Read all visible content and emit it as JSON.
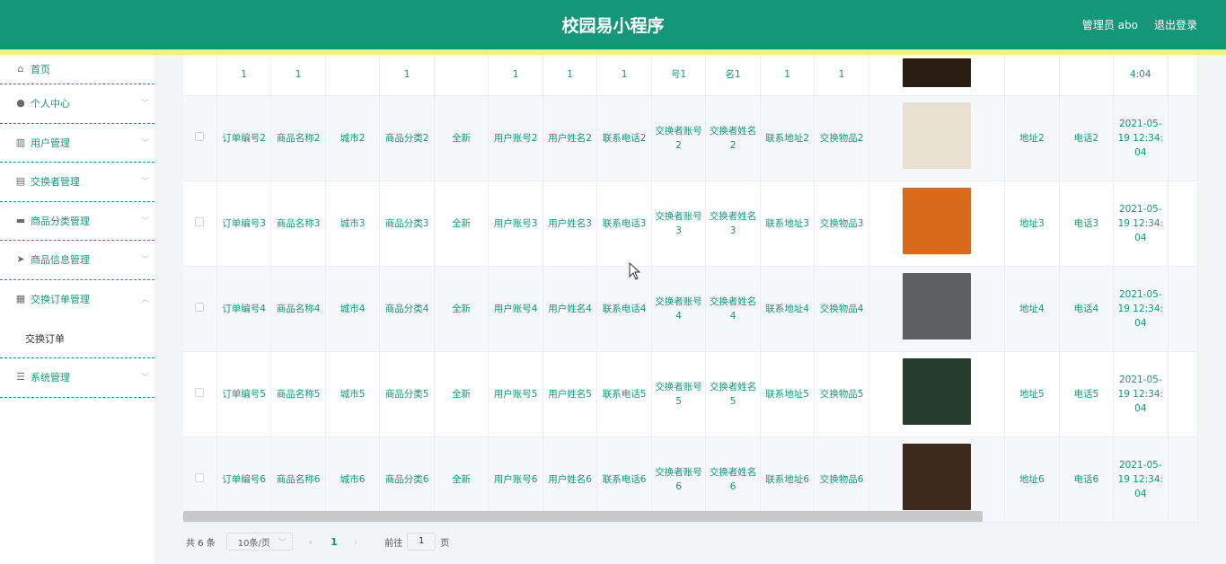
{
  "header": {
    "title": "校园易小程序",
    "admin": "管理员 abo",
    "logout": "退出登录",
    "accent": "#149778",
    "stripe": "#f6ef7a"
  },
  "sidebar": {
    "items": [
      {
        "label": "首页",
        "icon": "home-icon",
        "glyph": "⌂",
        "expanded": null
      },
      {
        "label": "个人中心",
        "icon": "user-icon",
        "glyph": "●",
        "expanded": false
      },
      {
        "label": "用户管理",
        "icon": "bar-chart-icon",
        "glyph": "▥",
        "expanded": false
      },
      {
        "label": "交换者管理",
        "icon": "clipboard-icon",
        "glyph": "▤",
        "expanded": false
      },
      {
        "label": "商品分类管理",
        "icon": "folder-icon",
        "glyph": "▬",
        "expanded": false
      },
      {
        "label": "商品信息管理",
        "icon": "send-icon",
        "glyph": "➤",
        "expanded": false
      },
      {
        "label": "交换订单管理",
        "icon": "grid-icon",
        "glyph": "▦",
        "expanded": true
      },
      {
        "label": "系统管理",
        "icon": "menu-icon",
        "glyph": "☰",
        "expanded": false
      }
    ],
    "submenu": "交换订单"
  },
  "table": {
    "partial_row": {
      "c1": "1",
      "c2": "1",
      "c4": "1",
      "c6": "1",
      "c7": "1",
      "c8": "1",
      "c9": "号1",
      "c10": "名1",
      "c11": "1",
      "c12": "1",
      "time": "4:04"
    },
    "rows": [
      {
        "order": "订单编号2",
        "goods": "商品名称2",
        "city": "城市2",
        "category": "商品分类2",
        "cond": "全新",
        "account": "用户账号2",
        "uname": "用户姓名2",
        "phone": "联系电话2",
        "xacc": "交换者账号2",
        "xname": "交换者姓名2",
        "addr": "联系地址2",
        "item": "交换物品2",
        "img_color": "#e9e1cf",
        "addr2": "地址2",
        "tel": "电话2",
        "time": "2021-05-19 12:34:04"
      },
      {
        "order": "订单编号3",
        "goods": "商品名称3",
        "city": "城市3",
        "category": "商品分类3",
        "cond": "全新",
        "account": "用户账号3",
        "uname": "用户姓名3",
        "phone": "联系电话3",
        "xacc": "交换者账号3",
        "xname": "交换者姓名3",
        "addr": "联系地址3",
        "item": "交换物品3",
        "img_color": "#d96a1c",
        "addr2": "地址3",
        "tel": "电话3",
        "time": "2021-05-19 12:34:04"
      },
      {
        "order": "订单编号4",
        "goods": "商品名称4",
        "city": "城市4",
        "category": "商品分类4",
        "cond": "全新",
        "account": "用户账号4",
        "uname": "用户姓名4",
        "phone": "联系电话4",
        "xacc": "交换者账号4",
        "xname": "交换者姓名4",
        "addr": "联系地址4",
        "item": "交换物品4",
        "img_color": "#5d5f62",
        "addr2": "地址4",
        "tel": "电话4",
        "time": "2021-05-19 12:34:04"
      },
      {
        "order": "订单编号5",
        "goods": "商品名称5",
        "city": "城市5",
        "category": "商品分类5",
        "cond": "全新",
        "account": "用户账号5",
        "uname": "用户姓名5",
        "phone": "联系电话5",
        "xacc": "交换者账号5",
        "xname": "交换者姓名5",
        "addr": "联系地址5",
        "item": "交换物品5",
        "img_color": "#263c2c",
        "addr2": "地址5",
        "tel": "电话5",
        "time": "2021-05-19 12:34:04"
      },
      {
        "order": "订单编号6",
        "goods": "商品名称6",
        "city": "城市6",
        "category": "商品分类6",
        "cond": "全新",
        "account": "用户账号6",
        "uname": "用户姓名6",
        "phone": "联系电话6",
        "xacc": "交换者账号6",
        "xname": "交换者姓名6",
        "addr": "联系地址6",
        "item": "交换物品6",
        "img_color": "#3e2a1c",
        "addr2": "地址6",
        "tel": "电话6",
        "time": "2021-05-19 12:34:04"
      }
    ]
  },
  "pager": {
    "total": "共 6 条",
    "size": "10条/页",
    "prev": "‹",
    "current": "1",
    "next": "›",
    "goto": "前往",
    "page_input": "1",
    "page_unit": "页"
  }
}
